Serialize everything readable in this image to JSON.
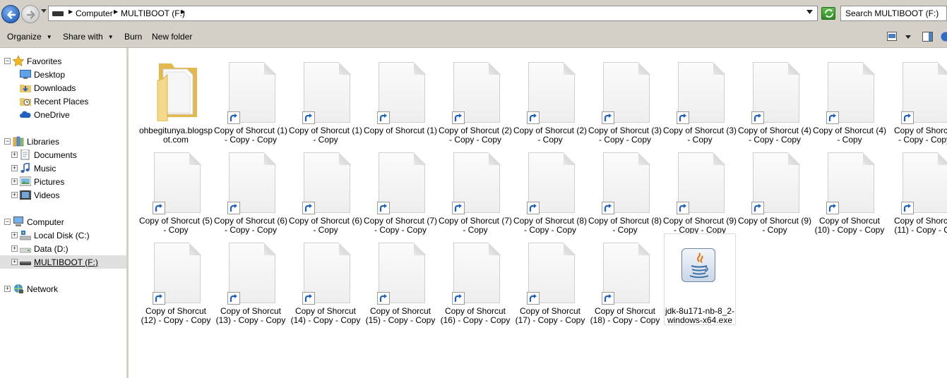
{
  "address": {
    "crumbs": [
      "Computer",
      "MULTIBOOT (F:)"
    ],
    "search_placeholder": "Search MULTIBOOT (F:)"
  },
  "toolbar": {
    "organize": "Organize",
    "share_with": "Share with",
    "burn": "Burn",
    "new_folder": "New folder"
  },
  "nav": {
    "favorites": "Favorites",
    "desktop": "Desktop",
    "downloads": "Downloads",
    "recent_places": "Recent Places",
    "onedrive": "OneDrive",
    "libraries": "Libraries",
    "documents": "Documents",
    "music": "Music",
    "pictures": "Pictures",
    "videos": "Videos",
    "computer": "Computer",
    "local_disk": "Local Disk (C:)",
    "data": "Data (D:)",
    "multiboot": "MULTIBOOT (F:)",
    "network": "Network"
  },
  "files": [
    {
      "type": "folder",
      "line1": "ohbegitunya.blogsp",
      "line2": "ot.com"
    },
    {
      "type": "shortcut",
      "line1": "Copy of Shorcut (1)",
      "line2": "- Copy - Copy"
    },
    {
      "type": "shortcut",
      "line1": "Copy of Shorcut (1)",
      "line2": "- Copy"
    },
    {
      "type": "shortcut",
      "line1": "Copy of Shorcut (1)",
      "line2": ""
    },
    {
      "type": "shortcut",
      "line1": "Copy of Shorcut (2)",
      "line2": "- Copy - Copy"
    },
    {
      "type": "shortcut",
      "line1": "Copy of Shorcut (2)",
      "line2": "- Copy"
    },
    {
      "type": "shortcut",
      "line1": "Copy of Shorcut (3)",
      "line2": "- Copy - Copy"
    },
    {
      "type": "shortcut",
      "line1": "Copy of Shorcut (3)",
      "line2": "- Copy"
    },
    {
      "type": "shortcut",
      "line1": "Copy of Shorcut (4)",
      "line2": "- Copy - Copy"
    },
    {
      "type": "shortcut",
      "line1": "Copy of Shorcut (4)",
      "line2": "- Copy"
    },
    {
      "type": "shortcut",
      "line1": "Copy of Shorcut",
      "line2": "- Copy - Copy"
    },
    {
      "type": "shortcut",
      "line1": "Copy of Shorcut (5)",
      "line2": "- Copy"
    },
    {
      "type": "shortcut",
      "line1": "Copy of Shorcut (6)",
      "line2": "- Copy - Copy"
    },
    {
      "type": "shortcut",
      "line1": "Copy of Shorcut (6)",
      "line2": "- Copy"
    },
    {
      "type": "shortcut",
      "line1": "Copy of Shorcut (7)",
      "line2": "- Copy - Copy"
    },
    {
      "type": "shortcut",
      "line1": "Copy of Shorcut (7)",
      "line2": "- Copy"
    },
    {
      "type": "shortcut",
      "line1": "Copy of Shorcut (8)",
      "line2": "- Copy - Copy"
    },
    {
      "type": "shortcut",
      "line1": "Copy of Shorcut (8)",
      "line2": "- Copy"
    },
    {
      "type": "shortcut",
      "line1": "Copy of Shorcut (9)",
      "line2": "- Copy - Copy"
    },
    {
      "type": "shortcut",
      "line1": "Copy of Shorcut (9)",
      "line2": "- Copy"
    },
    {
      "type": "shortcut",
      "line1": "Copy of Shorcut",
      "line2": "(10) - Copy - Copy"
    },
    {
      "type": "shortcut",
      "line1": "Copy of Shorcut",
      "line2": "(11) - Copy - Co"
    },
    {
      "type": "shortcut",
      "line1": "Copy of Shorcut",
      "line2": "(12) - Copy - Copy"
    },
    {
      "type": "shortcut",
      "line1": "Copy of Shorcut",
      "line2": "(13) - Copy - Copy"
    },
    {
      "type": "shortcut",
      "line1": "Copy of Shorcut",
      "line2": "(14) - Copy - Copy"
    },
    {
      "type": "shortcut",
      "line1": "Copy of Shorcut",
      "line2": "(15) - Copy - Copy"
    },
    {
      "type": "shortcut",
      "line1": "Copy of Shorcut",
      "line2": "(16) - Copy - Copy"
    },
    {
      "type": "shortcut",
      "line1": "Copy of Shorcut",
      "line2": "(17) - Copy - Copy"
    },
    {
      "type": "shortcut",
      "line1": "Copy of Shorcut",
      "line2": "(18) - Copy - Copy"
    },
    {
      "type": "java",
      "line1": "jdk-8u171-nb-8_2-",
      "line2": "windows-x64.exe"
    }
  ]
}
